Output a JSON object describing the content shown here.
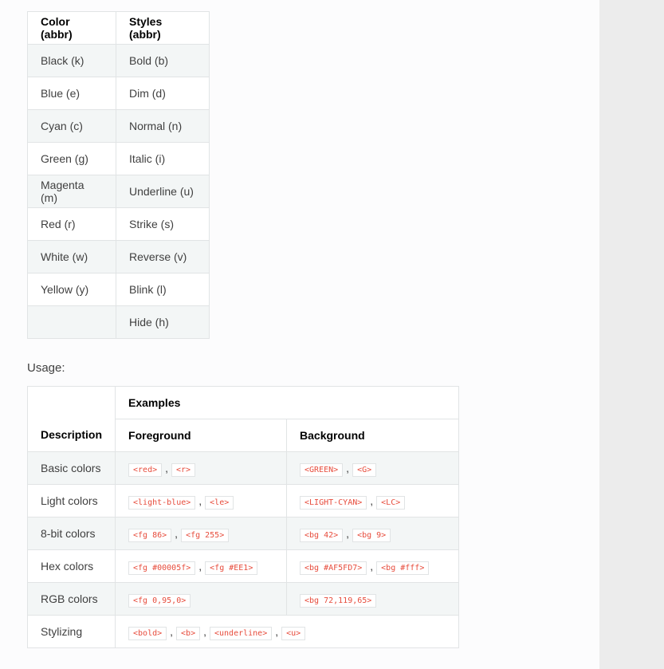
{
  "table1": {
    "headers": [
      "Color (abbr)",
      "Styles (abbr)"
    ],
    "rows": [
      [
        "Black (k)",
        "Bold (b)"
      ],
      [
        "Blue (e)",
        "Dim (d)"
      ],
      [
        "Cyan (c)",
        "Normal (n)"
      ],
      [
        "Green (g)",
        "Italic (i)"
      ],
      [
        "Magenta (m)",
        "Underline (u)"
      ],
      [
        "Red (r)",
        "Strike (s)"
      ],
      [
        "White (w)",
        "Reverse (v)"
      ],
      [
        "Yellow (y)",
        "Blink (l)"
      ],
      [
        "",
        "Hide (h)"
      ]
    ]
  },
  "usage_label": "Usage:",
  "table2": {
    "header_description": "Description",
    "header_examples": "Examples",
    "header_foreground": "Foreground",
    "header_background": "Background",
    "rows": [
      {
        "desc": "Basic colors",
        "fg": [
          "<red>",
          "<r>"
        ],
        "bg": [
          "<GREEN>",
          "<G>"
        ]
      },
      {
        "desc": "Light colors",
        "fg": [
          "<light-blue>",
          "<le>"
        ],
        "bg": [
          "<LIGHT-CYAN>",
          "<LC>"
        ]
      },
      {
        "desc": "8-bit colors",
        "fg": [
          "<fg 86>",
          "<fg 255>"
        ],
        "bg": [
          "<bg 42>",
          "<bg 9>"
        ]
      },
      {
        "desc": "Hex colors",
        "fg": [
          "<fg #00005f>",
          "<fg #EE1>"
        ],
        "bg": [
          "<bg #AF5FD7>",
          "<bg #fff>"
        ]
      },
      {
        "desc": "RGB colors",
        "fg": [
          "<fg 0,95,0>"
        ],
        "bg": [
          "<bg 72,119,65>"
        ]
      },
      {
        "desc": "Stylizing",
        "span": [
          "<bold>",
          "<b>",
          "<underline>",
          "<u>"
        ]
      }
    ]
  },
  "colors": {
    "code_text": "#e74c3c",
    "row_stripe": "#f3f6f6",
    "border": "#e1e4e5"
  }
}
